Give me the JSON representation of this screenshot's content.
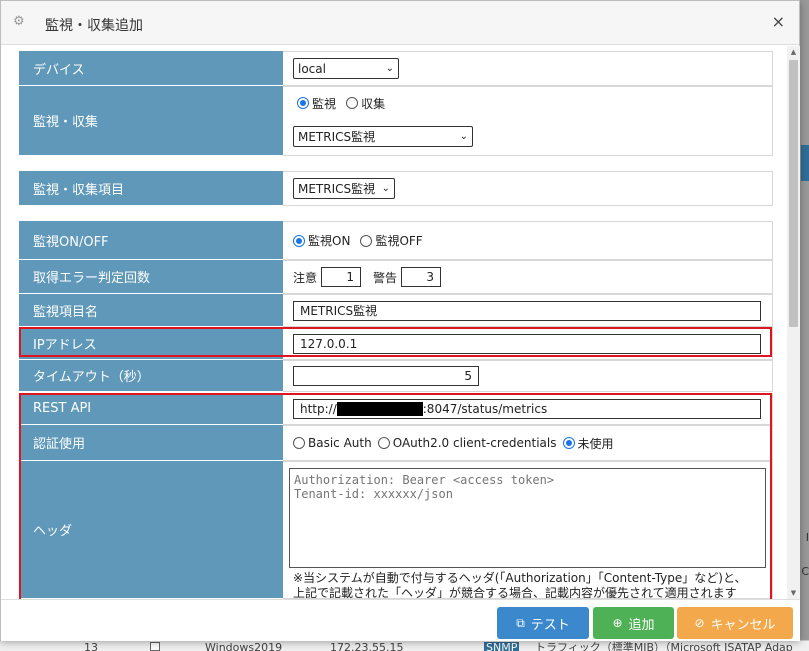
{
  "window": {
    "title": "監視・収集追加"
  },
  "form": {
    "device": {
      "label": "デバイス",
      "value": "local"
    },
    "monitor_collect": {
      "label": "監視・収集",
      "option_monitor": "監視",
      "option_collect": "収集",
      "selected": "監視",
      "type_value": "METRICS監視"
    },
    "item": {
      "label": "監視・収集項目",
      "value": "METRICS監視"
    },
    "onoff": {
      "label": "監視ON/OFF",
      "on": "監視ON",
      "off": "監視OFF",
      "selected": "監視ON"
    },
    "error_count": {
      "label": "取得エラー判定回数",
      "caution_label": "注意",
      "caution_value": "1",
      "warning_label": "警告",
      "warning_value": "3"
    },
    "item_name": {
      "label": "監視項目名",
      "value": "METRICS監視"
    },
    "ip": {
      "label": "IPアドレス",
      "value": "127.0.0.1"
    },
    "timeout": {
      "label": "タイムアウト（秒）",
      "value": "5"
    },
    "rest_api": {
      "label": "REST API",
      "value_prefix": "http://",
      "value_suffix": ":8047/status/metrics"
    },
    "auth": {
      "label": "認証使用",
      "basic": "Basic Auth",
      "oauth": "OAuth2.0 client-credentials",
      "none": "未使用",
      "selected": "未使用"
    },
    "header": {
      "label": "ヘッダ",
      "placeholder": "Authorization: Bearer <access token>\nTenant-id: xxxxxx/json",
      "note_line1": "※当システムが自動で付与するヘッダ(「Authorization」「Content-Type」など)と、",
      "note_line2": "上記で記載された「ヘッダ」が競合する場合、記載内容が優先されて適用されます"
    }
  },
  "footer": {
    "test_label": "テスト",
    "add_label": "追加",
    "cancel_label": "キャンセル"
  },
  "background": {
    "row_num": "13",
    "os": "Windows2019",
    "ip": "172.23.55.15",
    "badge": "SNMP",
    "text": "トラフィック（標準MIB）（Microsoft ISATAP Adap",
    "side_letters": [
      "I",
      "C"
    ]
  },
  "colors": {
    "label_bg": "#5f98b9",
    "highlight": "#e0141e",
    "test_btn": "#3b88cc",
    "add_btn": "#4fb156",
    "cancel_btn": "#f3a94b"
  }
}
